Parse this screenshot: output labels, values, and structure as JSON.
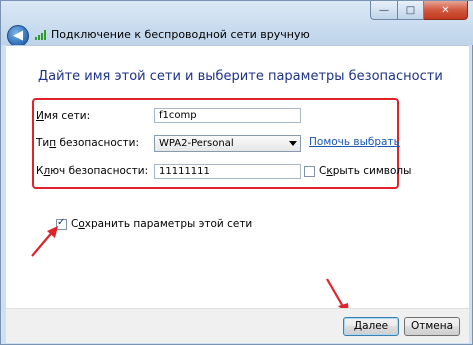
{
  "window": {
    "title": "Подключение к беспроводной сети вручную",
    "min_glyph": "—",
    "max_glyph": "□",
    "close_glyph": "✕",
    "back_glyph": "◀"
  },
  "page": {
    "heading": "Дайте имя этой сети и выберите параметры безопасности"
  },
  "form": {
    "network_name_label_u": "И",
    "network_name_label_rest": "мя сети:",
    "network_name_value": "f1comp",
    "security_type_label_pre": "Ти",
    "security_type_label_u": "п",
    "security_type_label_rest": " безопасности:",
    "security_type_value": "WPA2-Personal",
    "help_link": "Помочь выбрать",
    "key_label_pre": "К",
    "key_label_u": "л",
    "key_label_rest": "юч безопасности:",
    "key_value": "11111111",
    "hide_chars_pre": "С",
    "hide_chars_u": "к",
    "hide_chars_rest": "рыть символы",
    "hide_chars_checked": false,
    "save_params_pre": "С",
    "save_params_u": "о",
    "save_params_rest": "хранить параметры этой сети",
    "save_params_checked": true
  },
  "footer": {
    "next_label_u": "Д",
    "next_label_rest": "алее",
    "cancel_label": "Отмена"
  },
  "colors": {
    "highlight": "#e0232b",
    "heading": "#1e3287",
    "link": "#1a57b3"
  }
}
